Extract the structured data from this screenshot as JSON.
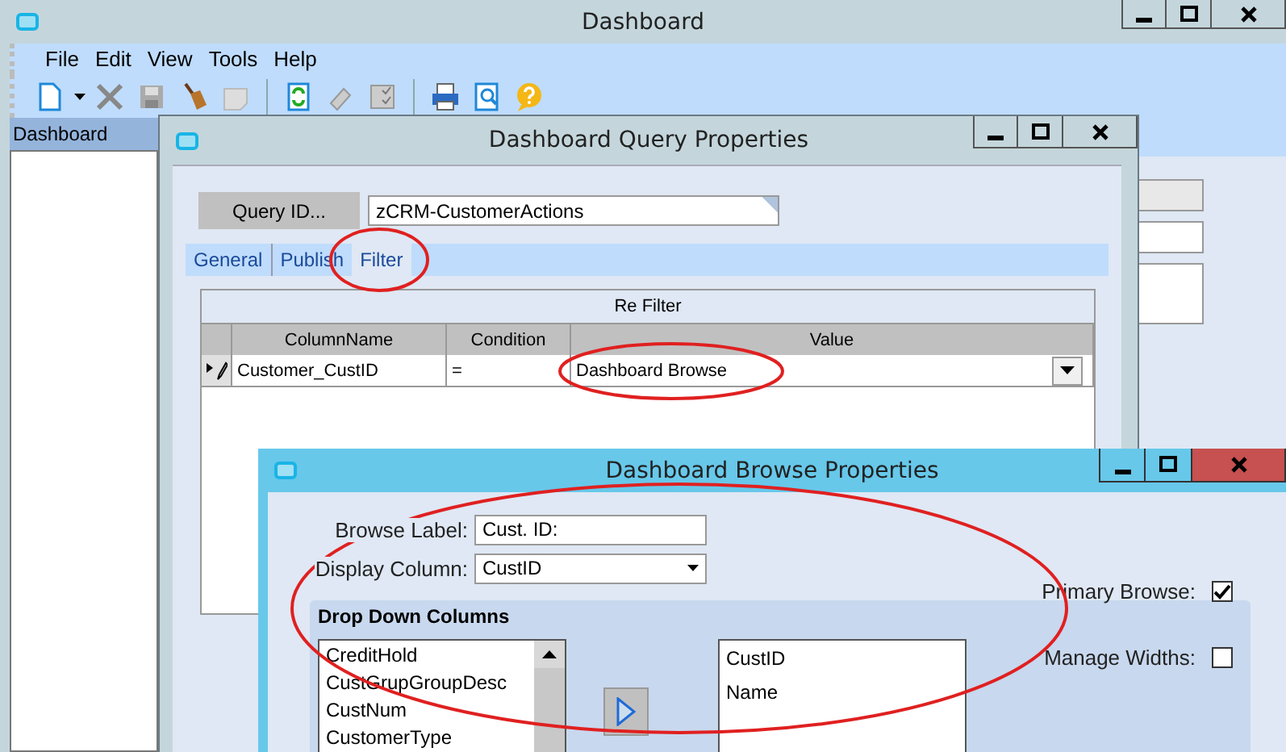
{
  "window": {
    "title": "Dashboard"
  },
  "menu": [
    "File",
    "Edit",
    "View",
    "Tools",
    "Help"
  ],
  "sidebar": {
    "title": "Dashboard"
  },
  "query_dialog": {
    "title": "Dashboard Query Properties",
    "query_id_button": "Query ID...",
    "query_id": "zCRM-CustomerActions",
    "tabs": [
      {
        "label": "General",
        "selected": false
      },
      {
        "label": "Publish",
        "selected": false
      },
      {
        "label": "Filter",
        "selected": true
      }
    ],
    "filter_table": {
      "title": "Re Filter",
      "columns": [
        "ColumnName",
        "Condition",
        "Value"
      ],
      "rows": [
        [
          "Customer_CustID",
          "=",
          "Dashboard Browse"
        ]
      ]
    }
  },
  "browse_dialog": {
    "title": "Dashboard Browse Properties",
    "browse_label": {
      "label": "Browse Label:",
      "value": "Cust. ID:"
    },
    "display_column": {
      "label": "Display Column:",
      "value": "CustID"
    },
    "primary_browse": {
      "label": "Primary Browse:",
      "checked": true
    },
    "manage_widths": {
      "label": "Manage Widths:",
      "checked": false
    },
    "drop_down_columns": {
      "title": "Drop Down Columns",
      "available": [
        "CreditHold",
        "CustGrupGroupDesc",
        "CustNum",
        "CustomerType"
      ],
      "selected_columns": [
        "CustID",
        "Name"
      ]
    }
  }
}
